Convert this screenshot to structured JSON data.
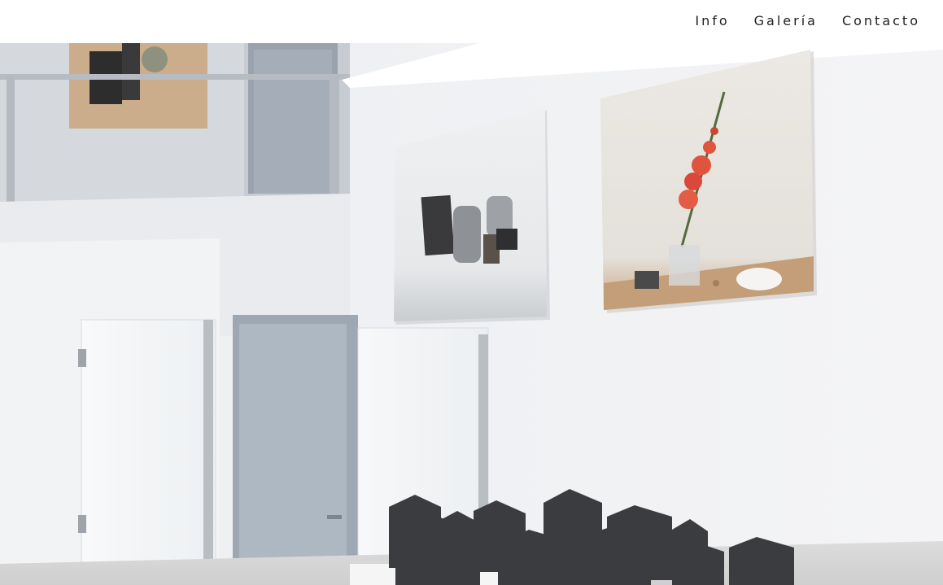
{
  "nav": {
    "items": [
      {
        "label": "Info"
      },
      {
        "label": "Galería"
      },
      {
        "label": "Contacto"
      }
    ]
  },
  "colors": {
    "nav_text": "#1f1f1f",
    "header_bg": "#ffffff",
    "wall": "#f0f1f3",
    "flower": "#e0533c"
  }
}
